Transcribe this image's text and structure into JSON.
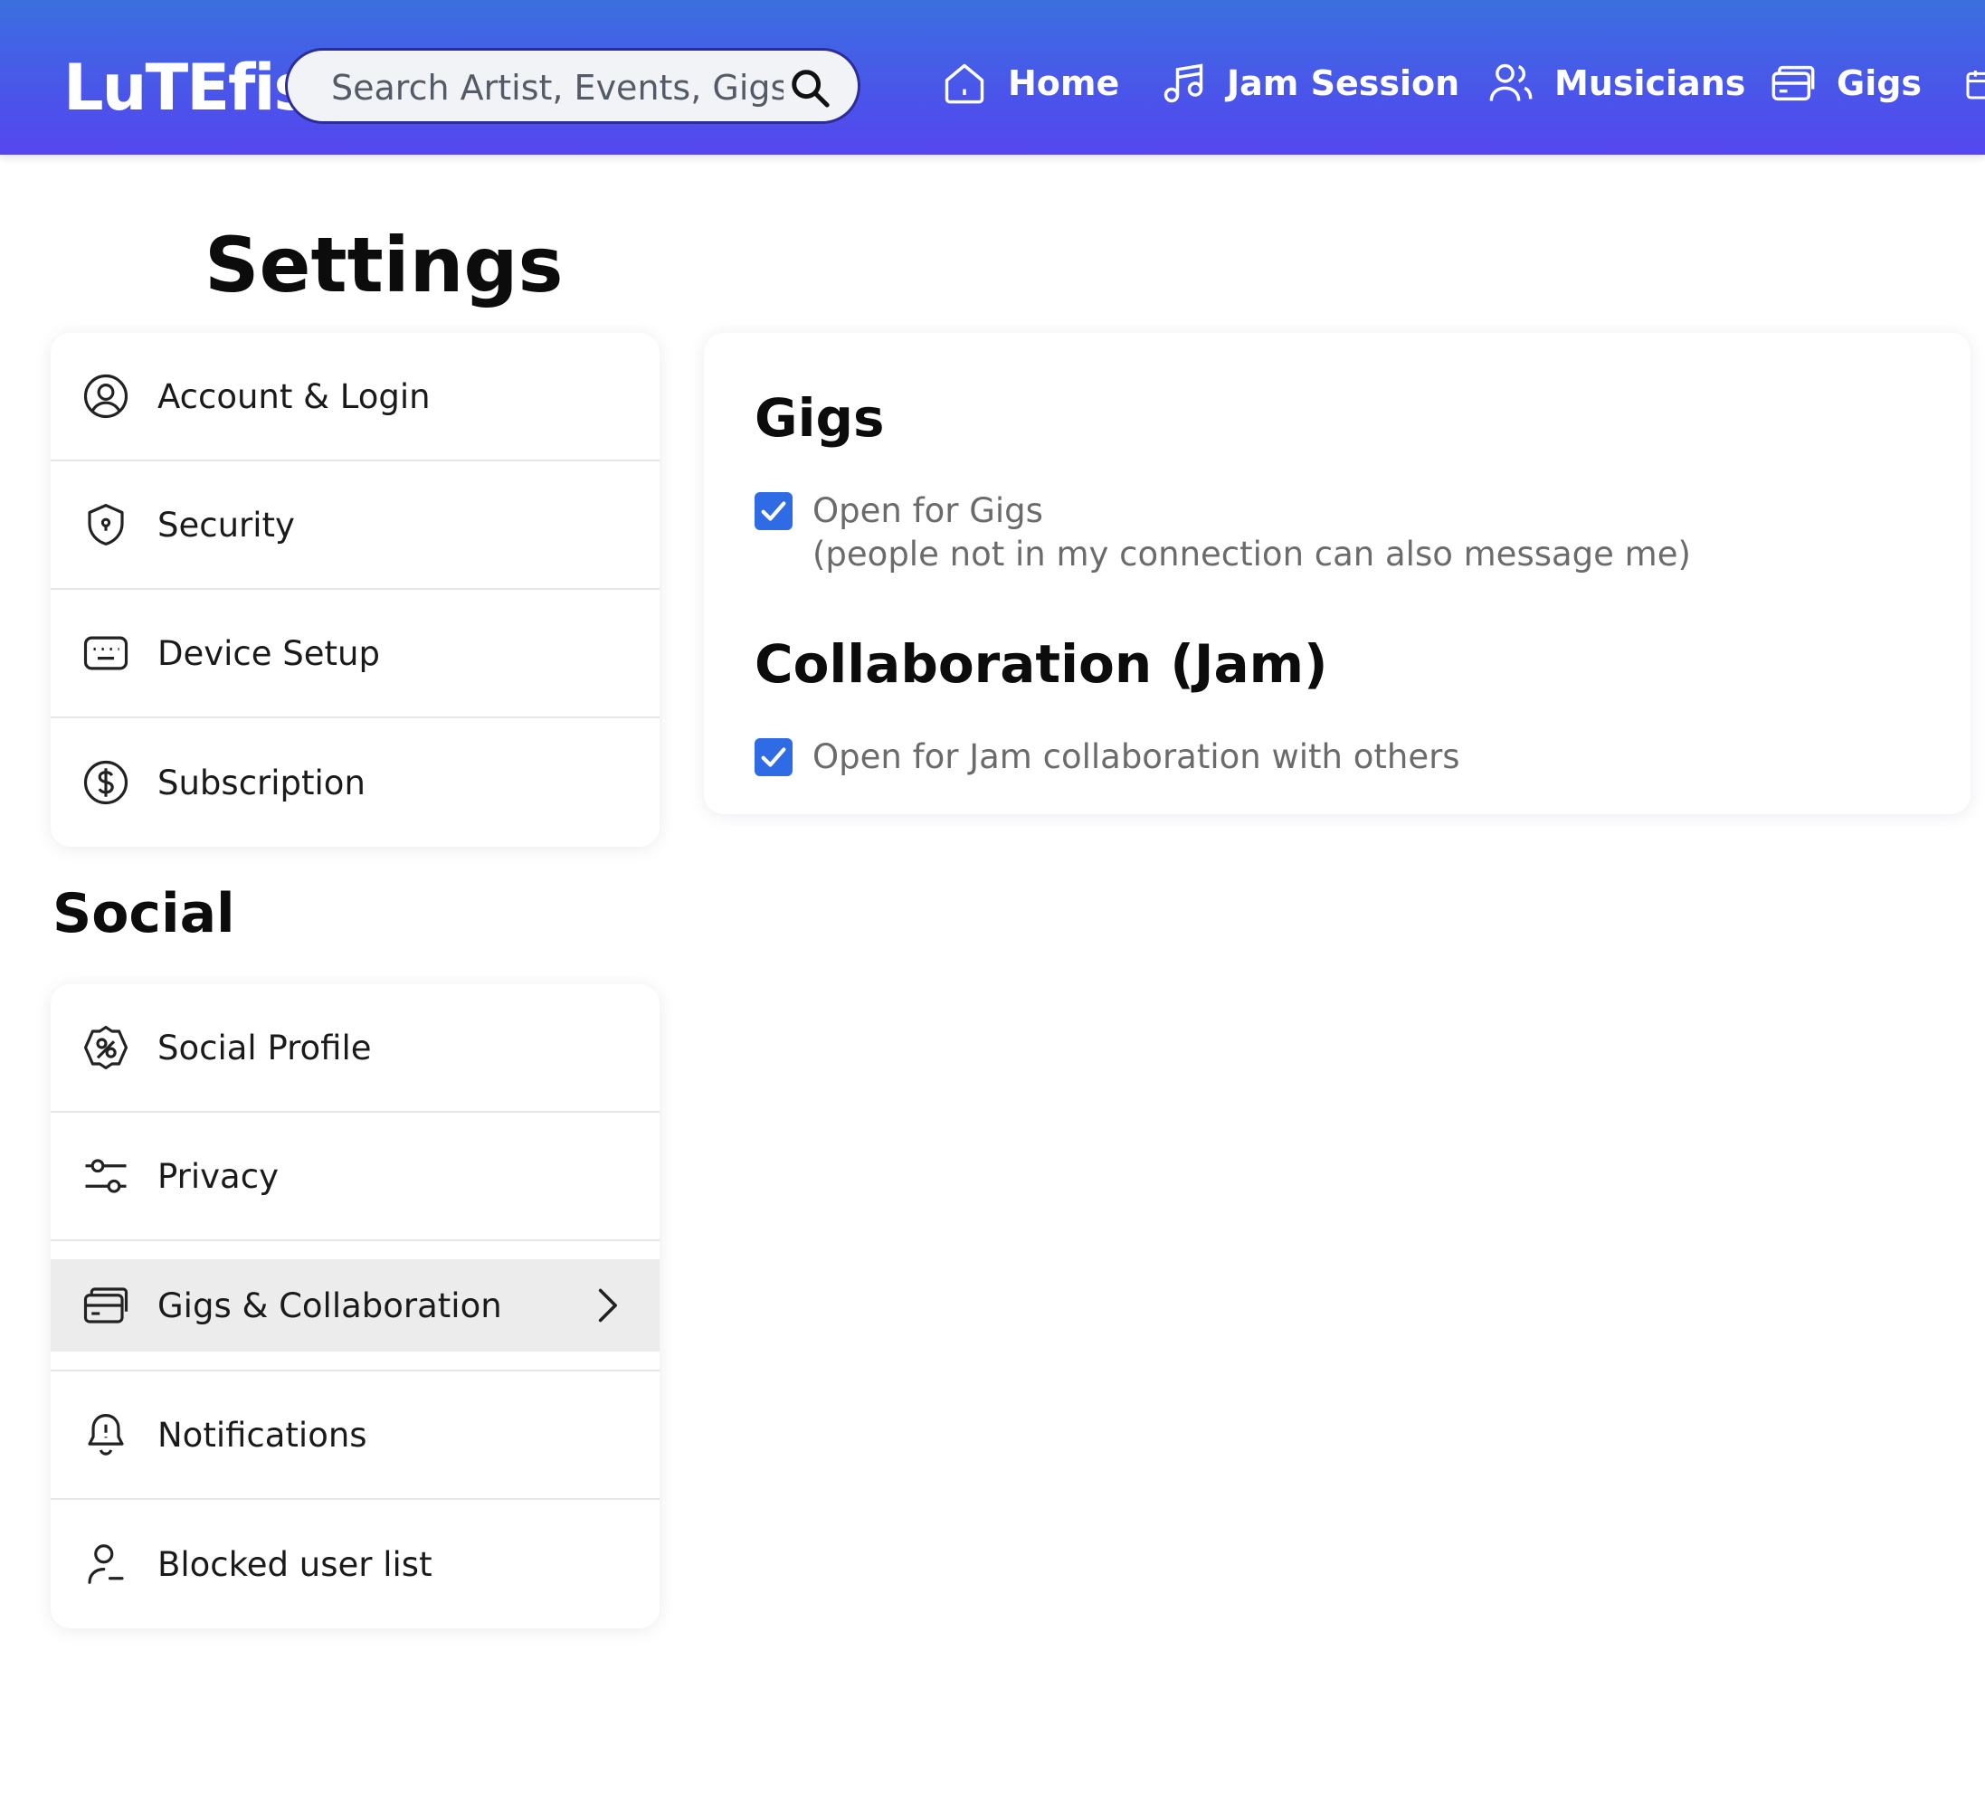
{
  "app": {
    "logo": "LuTEfish"
  },
  "colors": {
    "nav_start": "#3b6fe0",
    "nav_end": "#5546ee",
    "checkbox": "#2f6be4",
    "active_row": "#ececec"
  },
  "search": {
    "placeholder": "Search Artist, Events, Gigs",
    "icon": "search-icon"
  },
  "nav": [
    {
      "label": "Home",
      "icon": "home-icon"
    },
    {
      "label": "Jam Session",
      "icon": "music-note-icon"
    },
    {
      "label": "Musicians",
      "icon": "users-icon"
    },
    {
      "label": "Gigs",
      "icon": "gigs-card-icon"
    }
  ],
  "page": {
    "title": "Settings"
  },
  "settings_menu": [
    {
      "label": "Account & Login",
      "icon": "user-circle-icon"
    },
    {
      "label": "Security",
      "icon": "shield-icon"
    },
    {
      "label": "Device Setup",
      "icon": "keyboard-icon"
    },
    {
      "label": "Subscription",
      "icon": "dollar-circle-icon"
    }
  ],
  "social": {
    "title": "Social",
    "menu": [
      {
        "label": "Social Profile",
        "icon": "badge-icon"
      },
      {
        "label": "Privacy",
        "icon": "sliders-icon"
      },
      {
        "label": "Gigs & Collaboration",
        "icon": "gigs-card-icon",
        "active": true
      },
      {
        "label": "Notifications",
        "icon": "bell-icon"
      },
      {
        "label": "Blocked user list",
        "icon": "user-blocked-icon"
      }
    ]
  },
  "content": {
    "gigs": {
      "heading": "Gigs",
      "option_label": "Open for Gigs",
      "option_note": "(people not in my connection can also message me)",
      "checked": true
    },
    "collab": {
      "heading": "Collaboration (Jam)",
      "option_label": "Open for Jam collaboration with others",
      "checked": true
    }
  }
}
